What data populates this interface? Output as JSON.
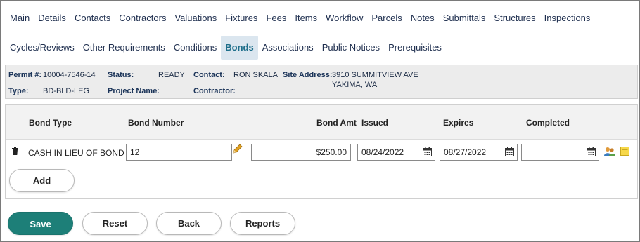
{
  "tabs_row1": [
    "Main",
    "Details",
    "Contacts",
    "Contractors",
    "Valuations",
    "Fixtures",
    "Fees",
    "Items",
    "Workflow",
    "Parcels",
    "Notes",
    "Submittals",
    "Structures",
    "Inspections"
  ],
  "tabs_row2": [
    "Cycles/Reviews",
    "Other Requirements",
    "Conditions",
    "Bonds",
    "Associations",
    "Public Notices",
    "Prerequisites"
  ],
  "active_tab": "Bonds",
  "permit_info": {
    "permit_label": "Permit #:",
    "permit_value": "10004-7546-14",
    "status_label": "Status:",
    "status_value": "READY",
    "contact_label": "Contact:",
    "contact_value": "RON SKALA",
    "site_label": "Site Address:",
    "site_line1": "3910 SUMMITVIEW AVE",
    "site_line2": "YAKIMA, WA",
    "type_label": "Type:",
    "type_value": "BD-BLD-LEG",
    "project_label": "Project Name:",
    "project_value": "",
    "contractor_label": "Contractor:",
    "contractor_value": ""
  },
  "grid": {
    "headers": {
      "bond_type": "Bond Type",
      "bond_number": "Bond Number",
      "bond_amt": "Bond Amt",
      "issued": "Issued",
      "expires": "Expires",
      "completed": "Completed"
    },
    "row": {
      "bond_type": "CASH IN LIEU OF BOND",
      "bond_number": "12",
      "bond_amt": "$250.00",
      "issued": "08/24/2022",
      "expires": "08/27/2022",
      "completed": ""
    },
    "add_label": "Add"
  },
  "footer": {
    "save": "Save",
    "reset": "Reset",
    "back": "Back",
    "reports": "Reports"
  },
  "icons": {
    "trash": "trash-icon",
    "pencil": "pencil-icon",
    "calendar": "calendar-icon",
    "people": "people-icon",
    "note": "sticky-note-icon"
  },
  "colors": {
    "primary": "#1d7f78",
    "active_tab_bg": "#dbe6ef",
    "active_tab_text": "#1d6e8a",
    "pencil": "#e0a020",
    "note": "#f7d84a"
  }
}
